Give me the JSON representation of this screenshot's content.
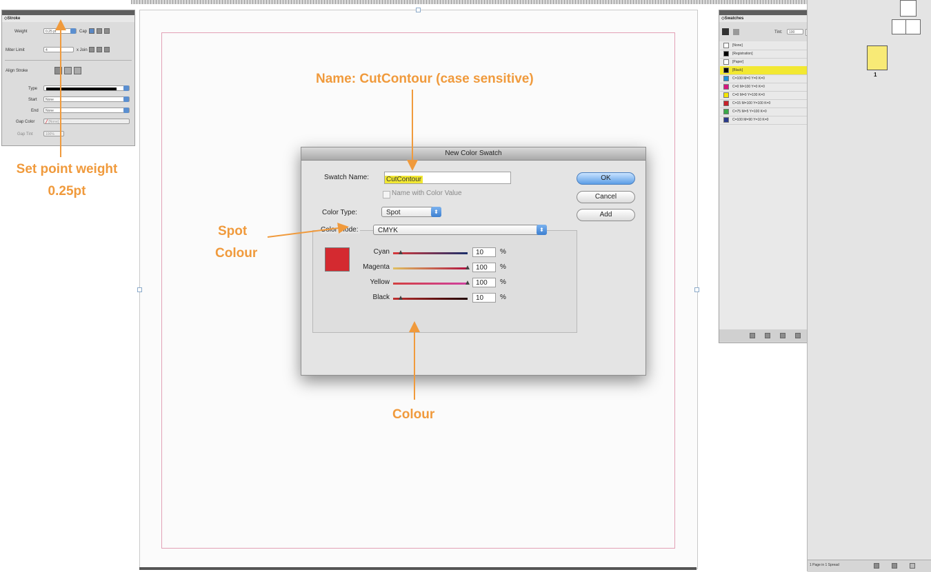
{
  "stroke_panel": {
    "tab": "◇Stroke",
    "weight_label": "Weight",
    "weight_value": "0.25 pt",
    "cap_label": "Cap",
    "miter_label": "Miter Limit",
    "miter_value": "4",
    "join_label": "x  Join",
    "align_label": "Align Stroke",
    "type_label": "Type",
    "start_label": "Start",
    "start_value": "None",
    "end_label": "End",
    "end_value": "None",
    "gap_color_label": "Gap Color",
    "gap_color_value": "[None]",
    "gap_tint_label": "Gap Tint",
    "gap_tint_value": "100%"
  },
  "swatches_panel": {
    "tab": "◇Swatches",
    "tint_label": "Tint:",
    "tint_value": "100",
    "items": [
      {
        "name": "[None]",
        "color": "#ffffff"
      },
      {
        "name": "[Registration]",
        "color": "#000000"
      },
      {
        "name": "[Paper]",
        "color": "#ffffff"
      },
      {
        "name": "[Black]",
        "color": "#000000"
      },
      {
        "name": "C=100 M=0 Y=0 K=0",
        "color": "#1e90d6"
      },
      {
        "name": "C=0 M=100 Y=0 K=0",
        "color": "#d6147f"
      },
      {
        "name": "C=0 M=0 Y=100 K=0",
        "color": "#f4e500"
      },
      {
        "name": "C=15 M=100 Y=100 K=0",
        "color": "#c8202a"
      },
      {
        "name": "C=75 M=5 Y=100 K=0",
        "color": "#3aa84a"
      },
      {
        "name": "C=100 M=90 Y=10 K=0",
        "color": "#2a3a8c"
      }
    ]
  },
  "pages_panel": {
    "page_number": "1",
    "status": "1 Page in 1 Spread"
  },
  "dialog": {
    "title": "New Color Swatch",
    "swatch_name_label": "Swatch Name:",
    "swatch_name_value": "CutContour",
    "name_with_value_label": "Name with Color Value",
    "color_type_label": "Color Type:",
    "color_type_value": "Spot",
    "color_mode_label": "Color Mode:",
    "color_mode_value": "CMYK",
    "ok": "OK",
    "cancel": "Cancel",
    "add": "Add",
    "preview_color": "#d42a30",
    "sliders": [
      {
        "label": "Cyan",
        "value": "10",
        "fraction": 0.1
      },
      {
        "label": "Magenta",
        "value": "100",
        "fraction": 1.0
      },
      {
        "label": "Yellow",
        "value": "100",
        "fraction": 1.0
      },
      {
        "label": "Black",
        "value": "10",
        "fraction": 0.1
      }
    ],
    "percent": "%"
  },
  "annotations": {
    "name": "Name: CutContour (case sensitive)",
    "weight_line1": "Set point weight",
    "weight_line2": "0.25pt",
    "spot_line1": "Spot",
    "spot_line2": "Colour",
    "colour": "Colour"
  },
  "colors": {
    "annotation": "#f09a3c",
    "highlight": "#f2e832"
  }
}
